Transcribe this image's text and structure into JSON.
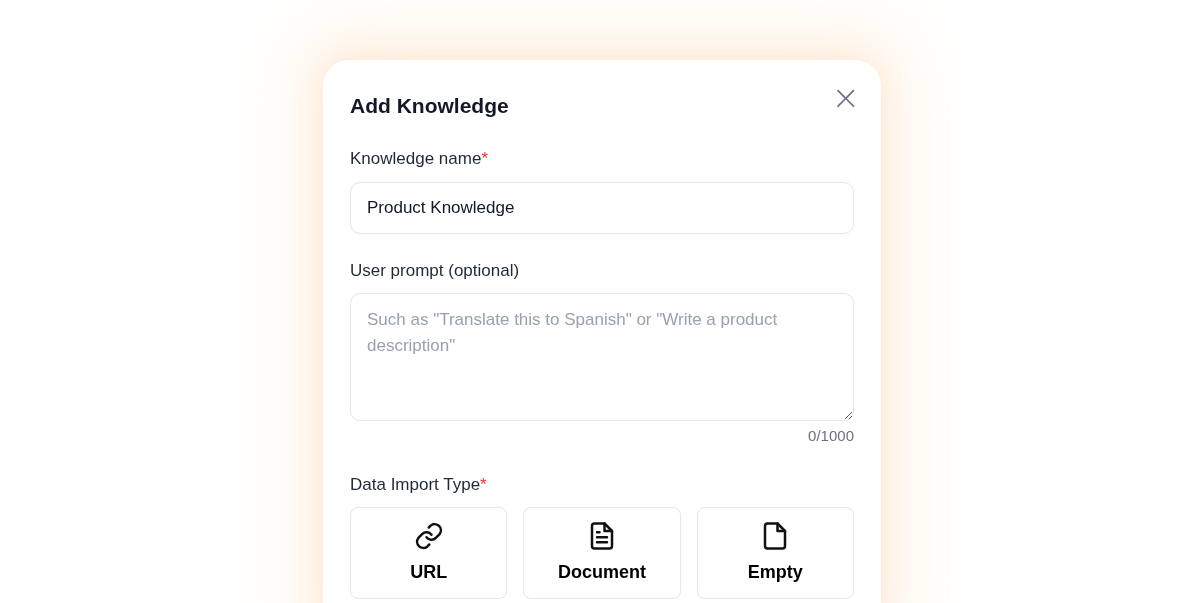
{
  "dialog": {
    "title": "Add Knowledge",
    "close": "×"
  },
  "name_field": {
    "label": "Knowledge name",
    "required_mark": "*",
    "value": "Product Knowledge"
  },
  "prompt_field": {
    "label": "User prompt (optional)",
    "placeholder": "Such as \"Translate this to Spanish\" or \"Write a product description\"",
    "counter": "0/1000"
  },
  "import_type": {
    "label": "Data Import Type",
    "required_mark": "*",
    "options": [
      {
        "kind": "link",
        "label": "URL",
        "selected": false
      },
      {
        "kind": "document",
        "label": "Document",
        "selected": false
      },
      {
        "kind": "empty",
        "label": "Empty",
        "selected": false
      }
    ]
  }
}
